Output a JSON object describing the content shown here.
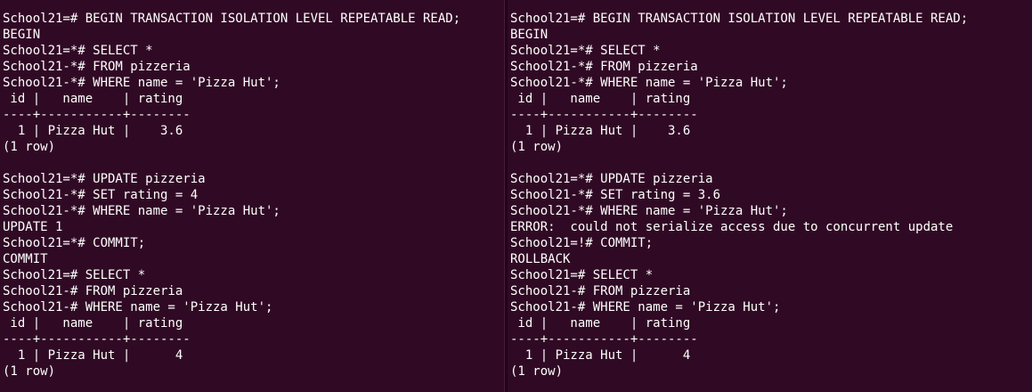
{
  "terminals": [
    {
      "lines": [
        "School21=# BEGIN TRANSACTION ISOLATION LEVEL REPEATABLE READ;",
        "BEGIN",
        "School21=*# SELECT *",
        "School21-*# FROM pizzeria",
        "School21-*# WHERE name = 'Pizza Hut';",
        " id |   name    | rating",
        "----+-----------+--------",
        "  1 | Pizza Hut |    3.6",
        "(1 row)",
        "",
        "School21=*# UPDATE pizzeria",
        "School21-*# SET rating = 4",
        "School21-*# WHERE name = 'Pizza Hut';",
        "UPDATE 1",
        "School21=*# COMMIT;",
        "COMMIT",
        "School21=# SELECT *",
        "School21-# FROM pizzeria",
        "School21-# WHERE name = 'Pizza Hut';",
        " id |   name    | rating",
        "----+-----------+--------",
        "  1 | Pizza Hut |      4",
        "(1 row)"
      ]
    },
    {
      "lines": [
        "School21=# BEGIN TRANSACTION ISOLATION LEVEL REPEATABLE READ;",
        "BEGIN",
        "School21=*# SELECT *",
        "School21-*# FROM pizzeria",
        "School21-*# WHERE name = 'Pizza Hut';",
        " id |   name    | rating",
        "----+-----------+--------",
        "  1 | Pizza Hut |    3.6",
        "(1 row)",
        "",
        "School21=*# UPDATE pizzeria",
        "School21-*# SET rating = 3.6",
        "School21-*# WHERE name = 'Pizza Hut';",
        "ERROR:  could not serialize access due to concurrent update",
        "School21=!# COMMIT;",
        "ROLLBACK",
        "School21=# SELECT *",
        "School21-# FROM pizzeria",
        "School21-# WHERE name = 'Pizza Hut';",
        " id |   name    | rating",
        "----+-----------+--------",
        "  1 | Pizza Hut |      4",
        "(1 row)"
      ]
    }
  ],
  "colors": {
    "background": "#300a24",
    "foreground": "#ffffff"
  }
}
